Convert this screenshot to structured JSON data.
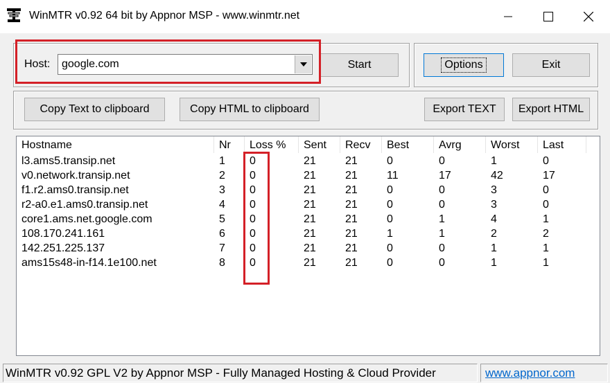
{
  "window": {
    "title": "WinMTR v0.92 64 bit by Appnor MSP - www.winmtr.net"
  },
  "host": {
    "label": "Host:",
    "value": "google.com"
  },
  "buttons": {
    "start": "Start",
    "options": "Options",
    "exit": "Exit",
    "copy_text": "Copy Text to clipboard",
    "copy_html": "Copy HTML to clipboard",
    "export_text": "Export TEXT",
    "export_html": "Export HTML"
  },
  "table": {
    "columns": [
      "Hostname",
      "Nr",
      "Loss %",
      "Sent",
      "Recv",
      "Best",
      "Avrg",
      "Worst",
      "Last"
    ],
    "rows": [
      [
        "l3.ams5.transip.net",
        "1",
        "0",
        "21",
        "21",
        "0",
        "0",
        "1",
        "0"
      ],
      [
        "v0.network.transip.net",
        "2",
        "0",
        "21",
        "21",
        "11",
        "17",
        "42",
        "17"
      ],
      [
        "f1.r2.ams0.transip.net",
        "3",
        "0",
        "21",
        "21",
        "0",
        "0",
        "3",
        "0"
      ],
      [
        "r2-a0.e1.ams0.transip.net",
        "4",
        "0",
        "21",
        "21",
        "0",
        "0",
        "3",
        "0"
      ],
      [
        "core1.ams.net.google.com",
        "5",
        "0",
        "21",
        "21",
        "0",
        "1",
        "4",
        "1"
      ],
      [
        "108.170.241.161",
        "6",
        "0",
        "21",
        "21",
        "1",
        "1",
        "2",
        "2"
      ],
      [
        "142.251.225.137",
        "7",
        "0",
        "21",
        "21",
        "0",
        "0",
        "1",
        "1"
      ],
      [
        "ams15s48-in-f14.1e100.net",
        "8",
        "0",
        "21",
        "21",
        "0",
        "0",
        "1",
        "1"
      ]
    ]
  },
  "status": {
    "text": "WinMTR v0.92 GPL V2 by Appnor MSP - Fully Managed Hosting & Cloud Provider",
    "link": "www.appnor.com"
  },
  "colors": {
    "highlight": "#d42027",
    "link": "#0066cc"
  }
}
